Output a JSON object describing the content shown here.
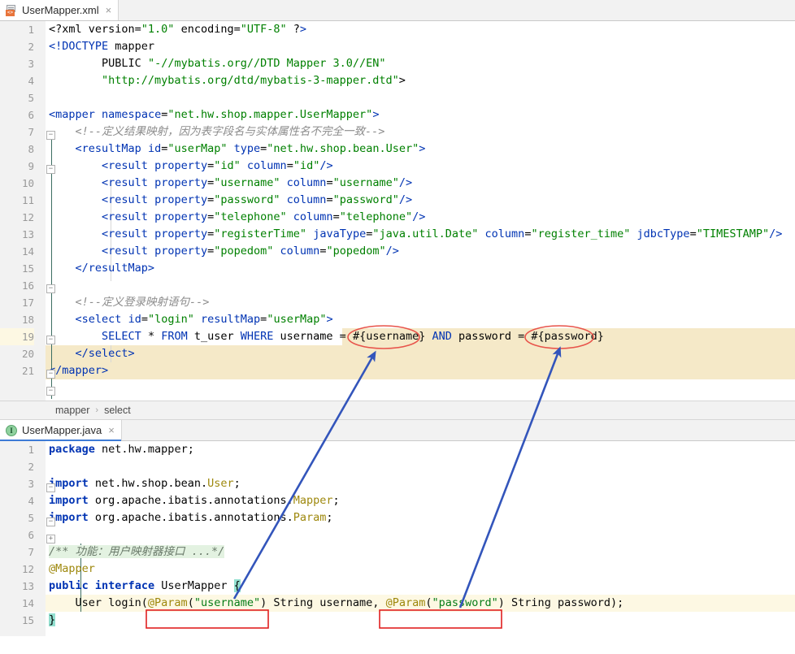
{
  "xml_tab": {
    "label": "UserMapper.xml",
    "icon": "xml-file-icon",
    "close": "×"
  },
  "java_tab": {
    "label": "UserMapper.java",
    "icon": "java-interface-icon",
    "badge": "I",
    "close": "×"
  },
  "breadcrumb": {
    "items": [
      "mapper",
      "select"
    ],
    "separator": "›"
  },
  "xml_editor": {
    "line_numbers": [
      "1",
      "2",
      "3",
      "4",
      "5",
      "6",
      "7",
      "8",
      "9",
      "10",
      "11",
      "12",
      "13",
      "14",
      "15",
      "16",
      "17",
      "18",
      "19",
      "20",
      "21"
    ],
    "lines": [
      "<?xml version=\"1.0\" encoding=\"UTF-8\" ?>",
      "<!DOCTYPE mapper",
      "        PUBLIC \"-//mybatis.org//DTD Mapper 3.0//EN\"",
      "        \"http://mybatis.org/dtd/mybatis-3-mapper.dtd\">",
      "",
      "<mapper namespace=\"net.hw.shop.mapper.UserMapper\">",
      "    <!--定义结果映射，因为表字段名与实体属性名不完全一致-->",
      "    <resultMap id=\"userMap\" type=\"net.hw.shop.bean.User\">",
      "        <result property=\"id\" column=\"id\"/>",
      "        <result property=\"username\" column=\"username\"/>",
      "        <result property=\"password\" column=\"password\"/>",
      "        <result property=\"telephone\" column=\"telephone\"/>",
      "        <result property=\"registerTime\" javaType=\"java.util.Date\" column=\"register_time\" jdbcType=\"TIMESTAMP\"/>",
      "        <result property=\"popedom\" column=\"popedom\"/>",
      "    </resultMap>",
      "",
      "    <!--定义登录映射语句-->",
      "    <select id=\"login\" resultMap=\"userMap\">",
      "        SELECT * FROM t_user WHERE username = #{username} AND password = #{password}",
      "    </select>",
      "</mapper>"
    ]
  },
  "java_editor": {
    "line_numbers": [
      "1",
      "2",
      "3",
      "4",
      "5",
      "6",
      "7",
      "12",
      "13",
      "14",
      "15"
    ],
    "lines": [
      "package net.hw.mapper;",
      "",
      "import net.hw.shop.bean.User;",
      "import org.apache.ibatis.annotations.Mapper;",
      "import org.apache.ibatis.annotations.Param;",
      "",
      "/** 功能：用户映射器接口 ...*/",
      "@Mapper",
      "public interface UserMapper {",
      "    User login(@Param(\"username\") String username, @Param(\"password\") String password);",
      "}"
    ]
  },
  "annotations": {
    "ellipse_1_target": "#{username}",
    "ellipse_2_target": "#{password}",
    "box_1_target": "@Param(\"username\")",
    "box_2_target": "@Param(\"password\")",
    "arrow_color": "#3355bb",
    "ellipse_color": "#e8544b",
    "box_color": "#e02020"
  },
  "colors": {
    "highlight_band": "#f5e9c8",
    "doc_comment_highlight": "#e3f2e1",
    "brace_match": "#93e0d0",
    "tab_active_underline": "#3d7bd6",
    "gutter_bg": "#f2f2f2"
  }
}
